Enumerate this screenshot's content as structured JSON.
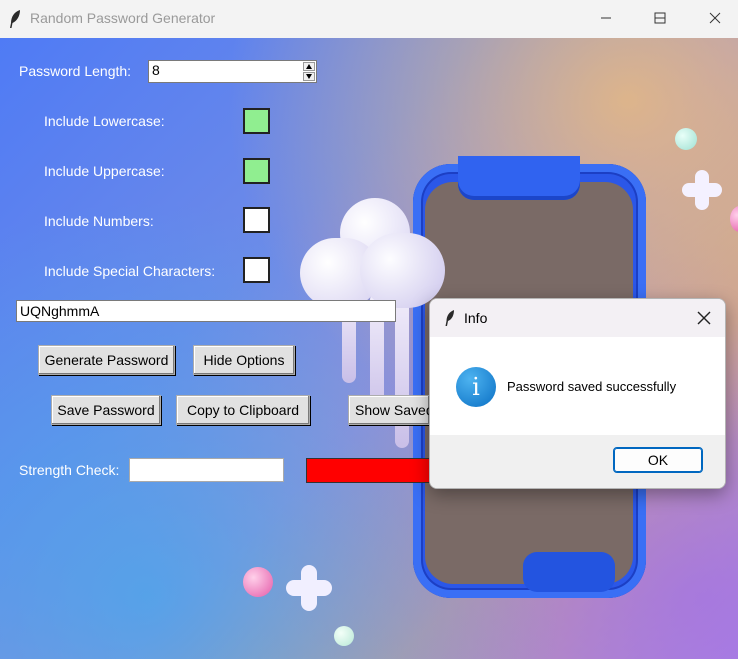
{
  "window": {
    "title": "Random Password Generator",
    "icon": "feather-icon",
    "controls": [
      "minimize-icon",
      "maximize-icon",
      "close-icon"
    ]
  },
  "form": {
    "length_label": "Password Length:",
    "length_value": "8",
    "lowercase_label": "Include Lowercase:",
    "lowercase_checked": true,
    "uppercase_label": "Include Uppercase:",
    "uppercase_checked": true,
    "numbers_label": "Include Numbers:",
    "numbers_checked": false,
    "special_label": "Include Special Characters:",
    "special_checked": false,
    "password_value": "UQNghmmA",
    "strength_label": "Strength Check:",
    "strength_value": "",
    "strength_color": "#ff0000",
    "checked_color": "#90ee90"
  },
  "buttons": {
    "generate": "Generate Password",
    "hide_options": "Hide Options",
    "save": "Save Password",
    "copy": "Copy to Clipboard",
    "show_saved": "Show Saved"
  },
  "dialog": {
    "title": "Info",
    "message": "Password saved successfully",
    "ok": "OK",
    "icon": "info-icon"
  }
}
